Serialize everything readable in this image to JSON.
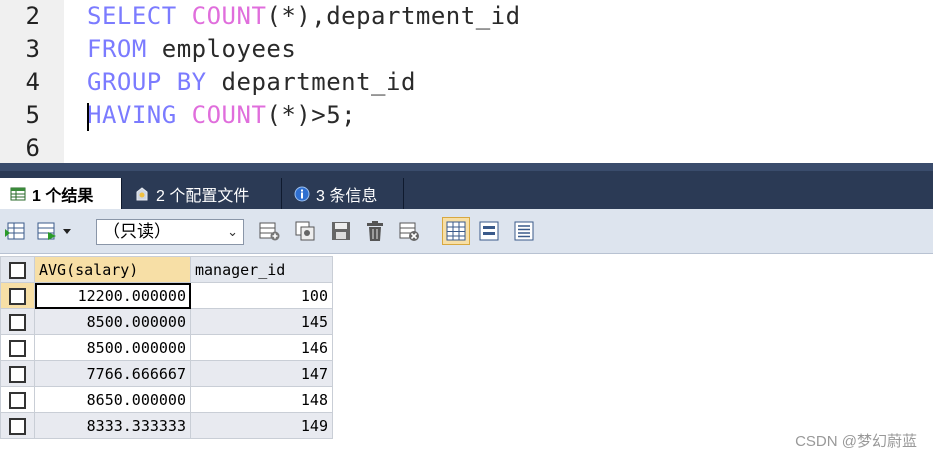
{
  "editor": {
    "lines": [
      {
        "no": "2",
        "tokens": [
          {
            "text": "SELECT ",
            "type": "keyword"
          },
          {
            "text": "COUNT",
            "type": "func"
          },
          {
            "text": "(*),department_id",
            "type": "ident"
          }
        ]
      },
      {
        "no": "3",
        "tokens": [
          {
            "text": "FROM ",
            "type": "keyword"
          },
          {
            "text": "employees",
            "type": "ident"
          }
        ]
      },
      {
        "no": "4",
        "tokens": [
          {
            "text": "GROUP BY ",
            "type": "keyword"
          },
          {
            "text": "department_id",
            "type": "ident"
          }
        ]
      },
      {
        "no": "5",
        "tokens": [
          {
            "text": "HAVING ",
            "type": "keyword"
          },
          {
            "text": "COUNT",
            "type": "func"
          },
          {
            "text": "(*)>5;",
            "type": "ident"
          }
        ]
      },
      {
        "no": "6",
        "tokens": []
      }
    ]
  },
  "tabs": [
    {
      "label": "1 个结果",
      "active": true,
      "icon": "result-grid-icon"
    },
    {
      "label": "2 个配置文件",
      "active": false,
      "icon": "profile-icon"
    },
    {
      "label": "3 条信息",
      "active": false,
      "icon": "info-icon"
    }
  ],
  "toolbar": {
    "mode_select": "（只读）"
  },
  "grid": {
    "columns": [
      "AVG(salary)",
      "manager_id"
    ],
    "rows": [
      [
        "12200.000000",
        "100"
      ],
      [
        "8500.000000",
        "145"
      ],
      [
        "8500.000000",
        "146"
      ],
      [
        "7766.666667",
        "147"
      ],
      [
        "8650.000000",
        "148"
      ],
      [
        "8333.333333",
        "149"
      ]
    ]
  },
  "watermark": "CSDN @梦幻蔚蓝",
  "colors": {
    "keyword": "#7b7bff",
    "function": "#e06edc",
    "tabbar": "#2b3a55",
    "toolbar": "#dde4ee",
    "selected_header": "#f7dfa6"
  }
}
